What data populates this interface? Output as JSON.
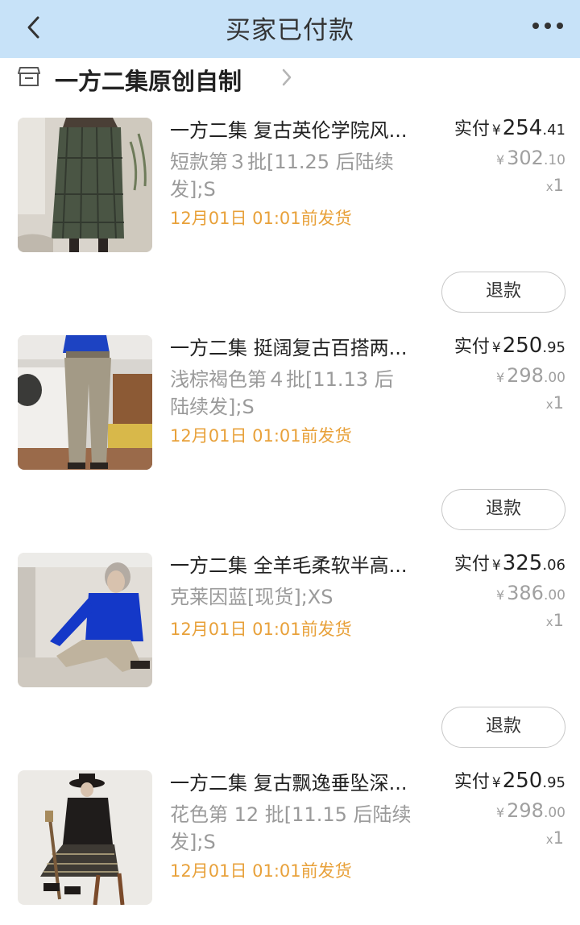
{
  "nav": {
    "title": "买家已付款",
    "back_icon": "chevron-left-icon",
    "more_icon": "more-dots-icon"
  },
  "shop": {
    "name": "一方二集原创自制",
    "icon": "store-icon",
    "arrow_icon": "chevron-right-icon"
  },
  "currency": "¥",
  "paid_label": "实付",
  "refund_label": "退款",
  "colors": {
    "nav_bg": "#c7e2f8",
    "ship_text": "#e8a13a",
    "muted": "#9a9a9a"
  },
  "items": [
    {
      "name": "一方二集 复古英伦学院风...",
      "variant": "短款第３批[11.25 后陆续发];S",
      "ship": "12月01日 01:01前发货",
      "paid_int": "254",
      "paid_dec": ".41",
      "orig_int": "302",
      "orig_dec": ".10",
      "qty_x": "x",
      "qty_n": "1"
    },
    {
      "name": "一方二集 挺阔复古百搭两...",
      "variant": "浅棕褐色第４批[11.13 后陆续发];S",
      "ship": "12月01日 01:01前发货",
      "paid_int": "250",
      "paid_dec": ".95",
      "orig_int": "298",
      "orig_dec": ".00",
      "qty_x": "x",
      "qty_n": "1"
    },
    {
      "name": "一方二集 全羊毛柔软半高...",
      "variant": "克莱因蓝[现货];XS",
      "ship": "12月01日 01:01前发货",
      "paid_int": "325",
      "paid_dec": ".06",
      "orig_int": "386",
      "orig_dec": ".00",
      "qty_x": "x",
      "qty_n": "1"
    },
    {
      "name": "一方二集 复古飘逸垂坠深...",
      "variant": "花色第 12 批[11.15 后陆续发];S",
      "ship": "12月01日 01:01前发货",
      "paid_int": "250",
      "paid_dec": ".95",
      "orig_int": "298",
      "orig_dec": ".00",
      "qty_x": "x",
      "qty_n": "1"
    }
  ]
}
